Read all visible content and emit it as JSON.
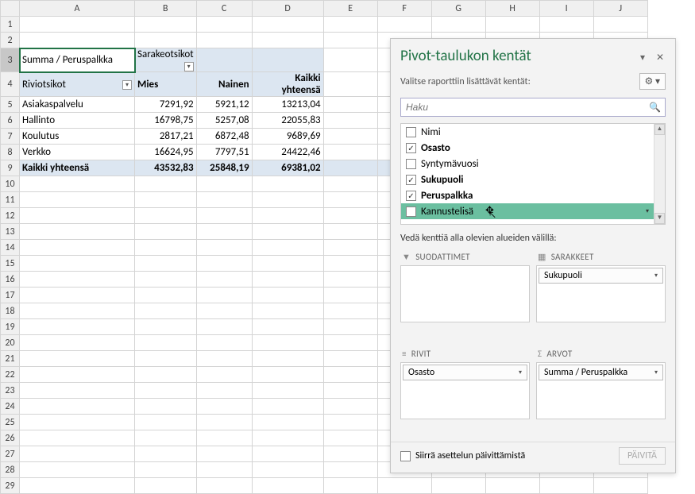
{
  "columns": [
    "A",
    "B",
    "C",
    "D",
    "E",
    "F",
    "G",
    "H",
    "I",
    "J"
  ],
  "rows_count": 29,
  "pivot": {
    "corner": "Summa  / Peruspalkka",
    "col_header_label": "Sarakeotsikot",
    "row_header_label": "Riviotsikot",
    "col_labels": [
      "Mies",
      "Nainen",
      "Kaikki yhteensä"
    ],
    "rows": [
      {
        "label": "Asiakaspalvelu",
        "vals": [
          "7291,92",
          "5921,12",
          "13213,04"
        ]
      },
      {
        "label": "Hallinto",
        "vals": [
          "16798,75",
          "5257,08",
          "22055,83"
        ]
      },
      {
        "label": "Koulutus",
        "vals": [
          "2817,21",
          "6872,48",
          "9689,69"
        ]
      },
      {
        "label": "Verkko",
        "vals": [
          "16624,95",
          "7797,51",
          "24422,46"
        ]
      }
    ],
    "total_label": "Kaikki yhteensä",
    "totals": [
      "43532,83",
      "25848,19",
      "69381,02"
    ]
  },
  "pane": {
    "title": "Pivot-taulukon kentät",
    "subtitle": "Valitse raporttiin lisättävät kentät:",
    "search_placeholder": "Haku",
    "fields": [
      {
        "name": "Nimi",
        "checked": false
      },
      {
        "name": "Osasto",
        "checked": true
      },
      {
        "name": "Syntymävuosi",
        "checked": false
      },
      {
        "name": "Sukupuoli",
        "checked": true
      },
      {
        "name": "Peruspalkka",
        "checked": true
      },
      {
        "name": "Kannustelisä",
        "checked": false,
        "hover": true
      }
    ],
    "drag_hint": "Vedä kenttiä alla olevien alueiden välillä:",
    "areas": {
      "filters_label": "SUODATTIMET",
      "columns_label": "SARAKKEET",
      "rows_label": "RIVIT",
      "values_label": "ARVOT",
      "columns_items": [
        "Sukupuoli"
      ],
      "rows_items": [
        "Osasto"
      ],
      "values_items": [
        "Summa  / Peruspalkka"
      ]
    },
    "defer_label": "Siirrä asettelun päivittämistä",
    "update_btn": "PÄIVITÄ"
  }
}
